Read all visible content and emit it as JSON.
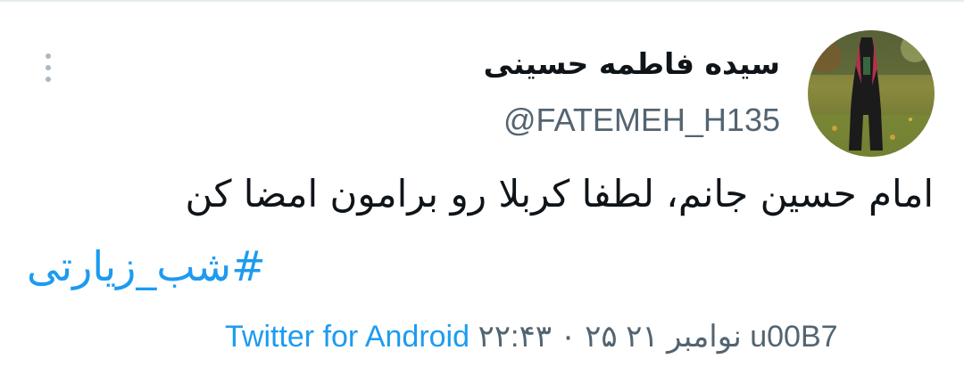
{
  "tweet": {
    "author": {
      "display_name": "سیده فاطمه حسینی",
      "handle": "@FATEMEH_H135"
    },
    "text": "امام حسین جانم، لطفا کربلا رو برامون امضا کن",
    "hashtag": "#شب_زیارتی",
    "timestamp": "۲۲:۴۳ ۰ ۲۵ نوامبر ۲۱ u00B7",
    "source": "Twitter for Android"
  },
  "colors": {
    "link": "#1d9bf0",
    "secondary_text": "#536471",
    "primary_text": "#0f1419"
  },
  "icons": {
    "more": "more-vertical-icon"
  }
}
